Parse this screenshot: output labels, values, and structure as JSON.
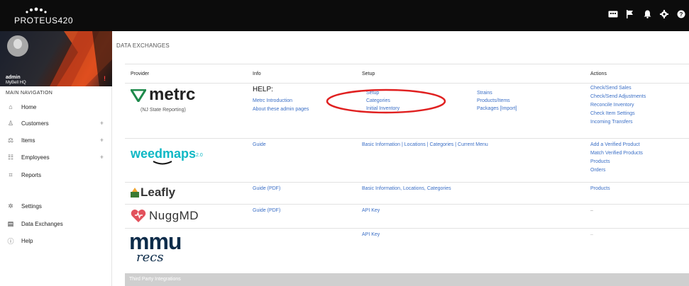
{
  "app": {
    "logo_text": "PROTEUS420"
  },
  "topbar_icons": [
    "keyboard-icon",
    "flag-icon",
    "bell-icon",
    "gear-icon",
    "help-icon"
  ],
  "user": {
    "name": "admin",
    "location": "MyBell HQ",
    "alert": "!"
  },
  "nav": {
    "header": "MAIN NAVIGATION",
    "items": [
      {
        "label": "Home",
        "icon": "home-icon",
        "expandable": false
      },
      {
        "label": "Customers",
        "icon": "customers-icon",
        "expandable": true
      },
      {
        "label": "Items",
        "icon": "items-icon",
        "expandable": true
      },
      {
        "label": "Employees",
        "icon": "employees-icon",
        "expandable": true
      },
      {
        "label": "Reports",
        "icon": "reports-icon",
        "expandable": false
      },
      {
        "label": "Settings",
        "icon": "gear-icon",
        "expandable": false
      },
      {
        "label": "Data Exchanges",
        "icon": "data-exchanges-icon",
        "expandable": false
      },
      {
        "label": "Help",
        "icon": "help-icon",
        "expandable": false
      }
    ]
  },
  "page": {
    "title": "DATA EXCHANGES"
  },
  "table": {
    "headers": {
      "provider": "Provider",
      "info": "Info",
      "setup": "Setup",
      "actions": "Actions"
    },
    "rows": [
      {
        "provider": "metrc",
        "provider_sub": "(NJ State Reporting)",
        "info_title": "HELP:",
        "info": [
          "Metrc Introduction",
          "About these admin pages"
        ],
        "setup_col1": [
          "Setup",
          "Categories",
          "Initial Inventory"
        ],
        "setup_col2": [
          "Strains",
          "Products/Items",
          "Packages [Import]"
        ],
        "actions": [
          "Check/Send Sales",
          "Check/Send Adjustments",
          "Reconcile Inventory",
          "Check Item Settings",
          "Incoming Transfers"
        ]
      },
      {
        "provider": "weedmaps",
        "provider_version": "2.0",
        "info": [
          "Guide"
        ],
        "setup": "Basic Information | Locations | Categories | Current Menu",
        "actions": [
          "Add a Verified Product",
          "Match Verified Products",
          "Products",
          "Orders"
        ]
      },
      {
        "provider": "Leafly",
        "info": [
          "Guide (PDF)"
        ],
        "setup": "Basic Information, Locations, Categories",
        "actions": [
          "Products"
        ]
      },
      {
        "provider": "NuggMD",
        "info": [
          "Guide (PDF)"
        ],
        "setup": "API Key",
        "actions_text": "–"
      },
      {
        "provider": "mmu",
        "provider_sub": "recs",
        "setup": "API Key",
        "actions_text": "–"
      }
    ]
  },
  "footer_band": "Third Party Integrations",
  "colors": {
    "link": "#3b6fc6",
    "metrc_green": "#1f8a4c",
    "weedmaps_teal": "#0fb8c5",
    "leafly_green": "#3c7b33",
    "nuggmd_red": "#e2515c",
    "mmu_navy": "#0d2c4a",
    "annotation_red": "#e02020"
  }
}
